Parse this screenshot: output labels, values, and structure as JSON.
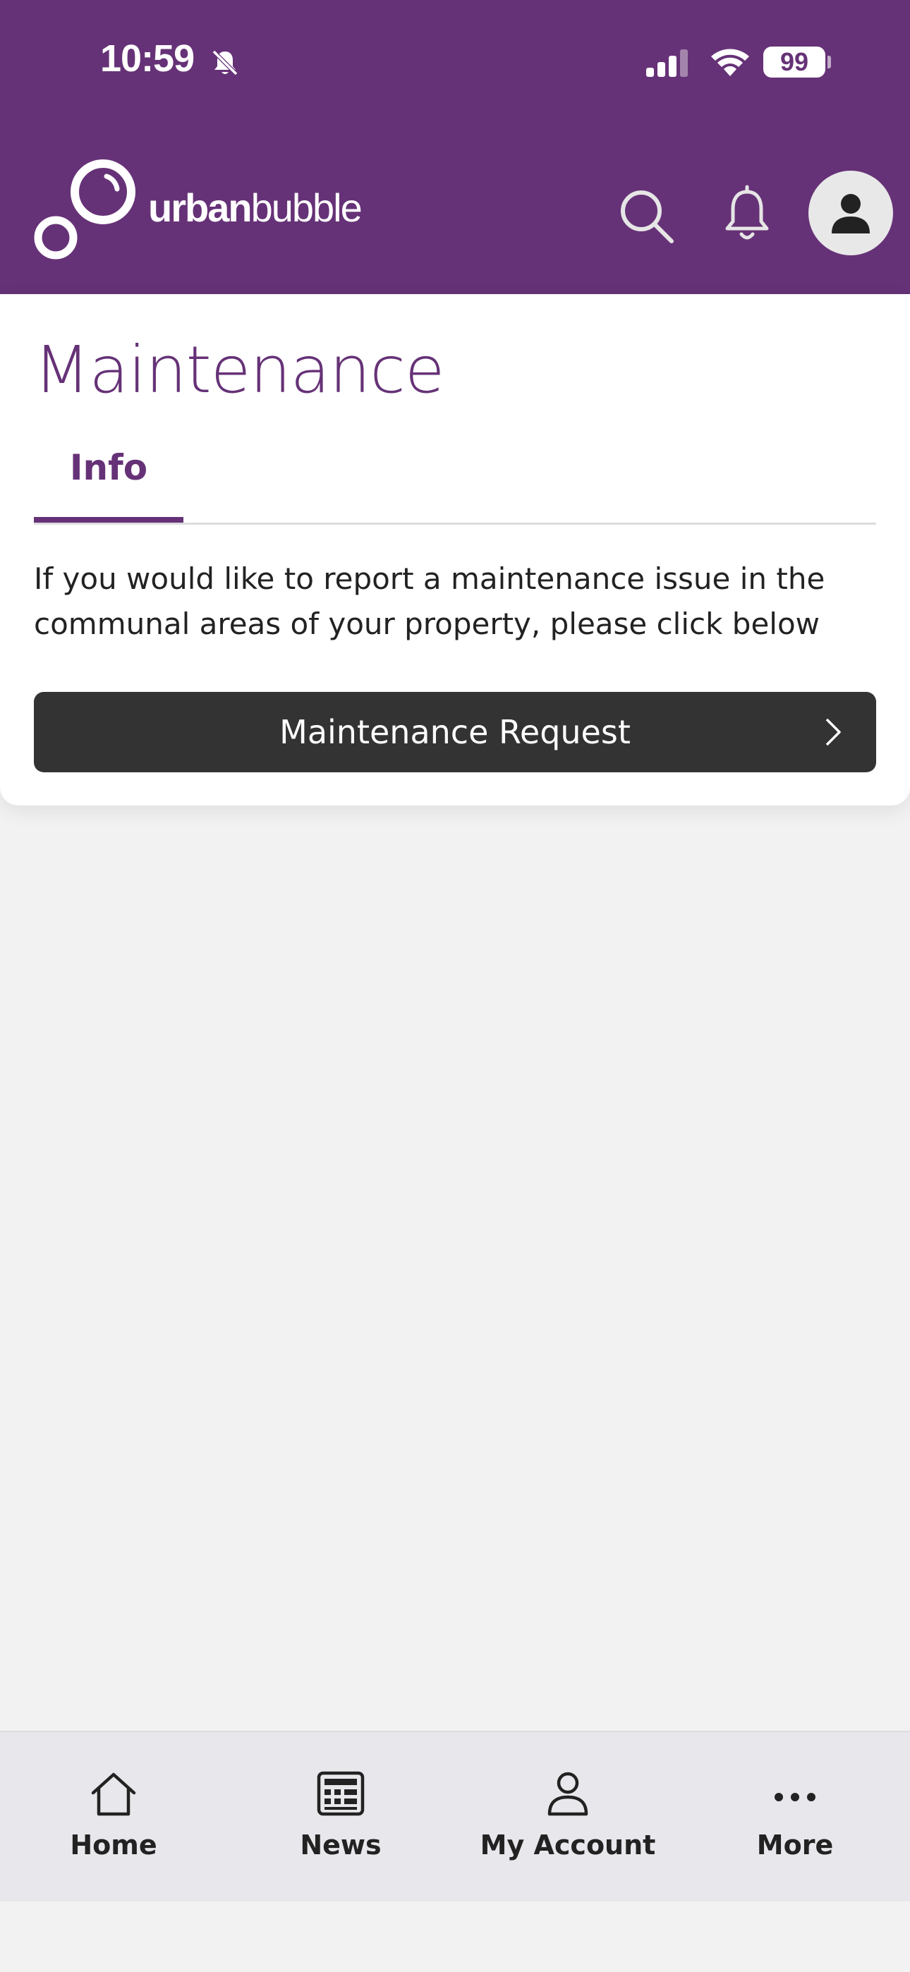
{
  "status_bar": {
    "time": "10:59",
    "battery": "99"
  },
  "header": {
    "logo_bold": "urban",
    "logo_light": "bubble",
    "brand_color": "#663277"
  },
  "page": {
    "title": "Maintenance",
    "tabs": [
      {
        "label": "Info",
        "active": true
      }
    ],
    "info_text": "If you would like to report a maintenance issue in the communal areas of your property, please click below",
    "cta_label": "Maintenance Request"
  },
  "bottom_nav": {
    "items": [
      {
        "label": "Home",
        "icon": "home-icon"
      },
      {
        "label": "News",
        "icon": "newspaper-icon"
      },
      {
        "label": "My Account",
        "icon": "person-icon"
      },
      {
        "label": "More",
        "icon": "ellipsis-icon"
      }
    ]
  }
}
